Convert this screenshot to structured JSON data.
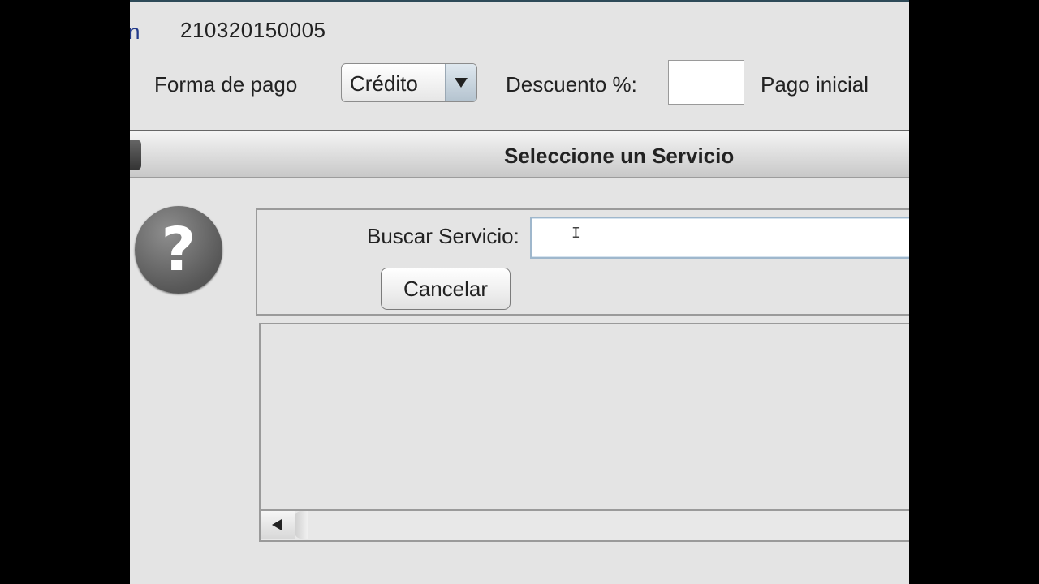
{
  "header": {
    "cut_glyph": "n",
    "invoice_number": "210320150005",
    "forma_de_pago_label": "Forma de pago",
    "forma_de_pago_value": "Crédito",
    "descuento_label": "Descuento %:",
    "descuento_value": "",
    "pago_inicial_label": "Pago inicial"
  },
  "dialog": {
    "title": "Seleccione un Servicio",
    "icon": "question-icon",
    "icon_glyph": "?",
    "search_label": "Buscar Servicio:",
    "search_value": "",
    "cancel_label": "Cancelar"
  },
  "colors": {
    "window_bg": "#e4e4e4",
    "top_accent": "#2e4a58",
    "input_focus_border": "#9fb7cc"
  }
}
